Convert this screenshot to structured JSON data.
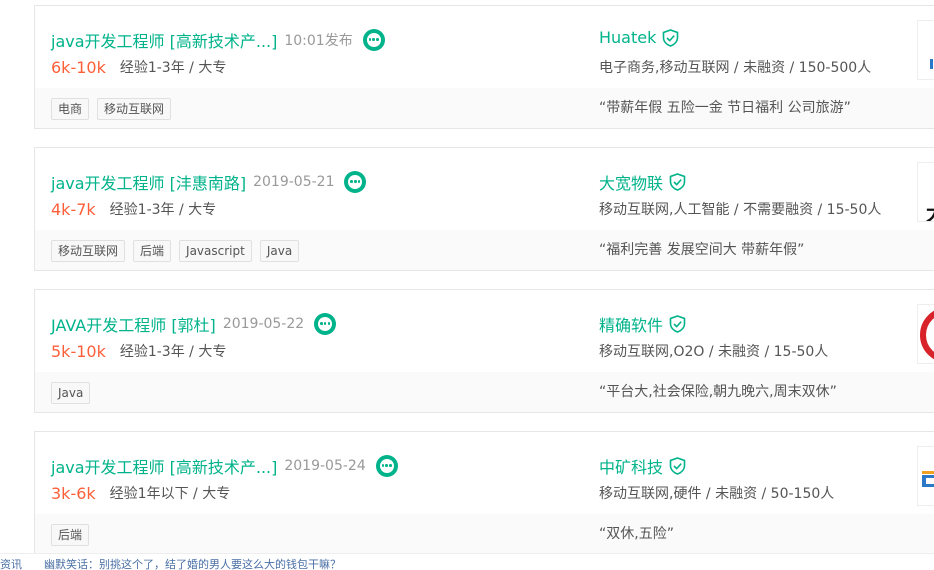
{
  "jobs": [
    {
      "title": "java开发工程师 [高新技术产...]",
      "date": "10:01发布",
      "salary": "6k-10k",
      "requirement": "经验1-3年 / 大专",
      "company": "Huatek",
      "company_info": "电子商务,移动互联网 / 未融资 / 150-500人",
      "tags": [
        "电商",
        "移动互联网"
      ],
      "benefits": "“带薪年假 五险一金 节日福利 公司旅游”",
      "logo_text": ""
    },
    {
      "title": "java开发工程师 [沣惠南路]",
      "date": "2019-05-21",
      "salary": "4k-7k",
      "requirement": "经验1-3年 / 大专",
      "company": "大宽物联",
      "company_info": "移动互联网,人工智能 / 不需要融资 / 15-50人",
      "tags": [
        "移动互联网",
        "后端",
        "Javascript",
        "Java"
      ],
      "benefits": "“福利完善 发展空间大 带薪年假”",
      "logo_text": "大"
    },
    {
      "title": "JAVA开发工程师 [郭杜]",
      "date": "2019-05-22",
      "salary": "5k-10k",
      "requirement": "经验1-3年 / 大专",
      "company": "精确软件",
      "company_info": "移动互联网,O2O / 未融资 / 15-50人",
      "tags": [
        "Java"
      ],
      "benefits": "“平台大,社会保险,朝九晚六,周末双休”",
      "logo_text": ""
    },
    {
      "title": "java开发工程师 [高新技术产...]",
      "date": "2019-05-24",
      "salary": "3k-6k",
      "requirement": "经验1年以下 / 大专",
      "company": "中矿科技",
      "company_info": "移动互联网,硬件 / 未融资 / 50-150人",
      "tags": [
        "后端"
      ],
      "benefits": "“双休,五险”",
      "logo_text": ""
    }
  ],
  "ticker": {
    "left": "资讯",
    "headline": "幽默笑话：别挑这个了，结了婚的男人要这么大的钱包干嘛？"
  },
  "colors": {
    "accent": "#00b38a",
    "salary": "#fd5f39"
  },
  "icons": [
    "chat-icon",
    "verified-shield-icon"
  ]
}
